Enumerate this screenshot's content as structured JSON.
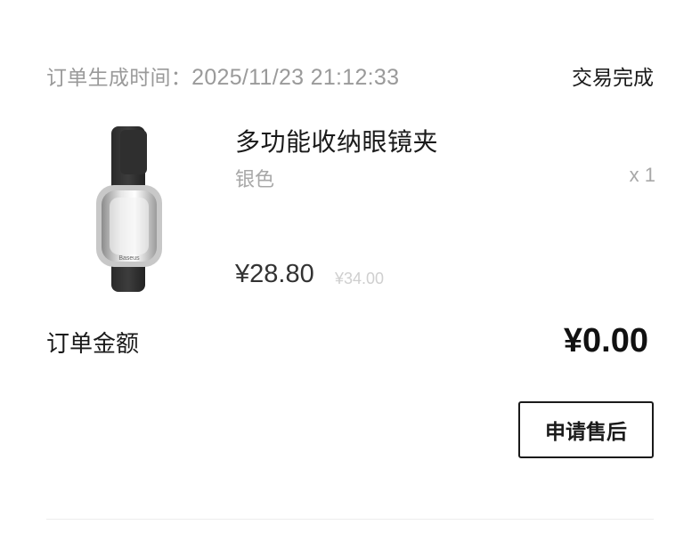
{
  "order": {
    "time_label": "订单生成时间：",
    "time_value": "2025/11/23 21:12:33",
    "status": "交易完成"
  },
  "product": {
    "title": "多功能收纳眼镜夹",
    "variant": "银色",
    "quantity": "x 1",
    "price": "¥28.80",
    "original_price": "¥34.00",
    "image_brand_text": "Baseus"
  },
  "summary": {
    "amount_label": "订单金额",
    "amount_value": "¥0.00"
  },
  "actions": {
    "after_sale_label": "申请售后"
  }
}
